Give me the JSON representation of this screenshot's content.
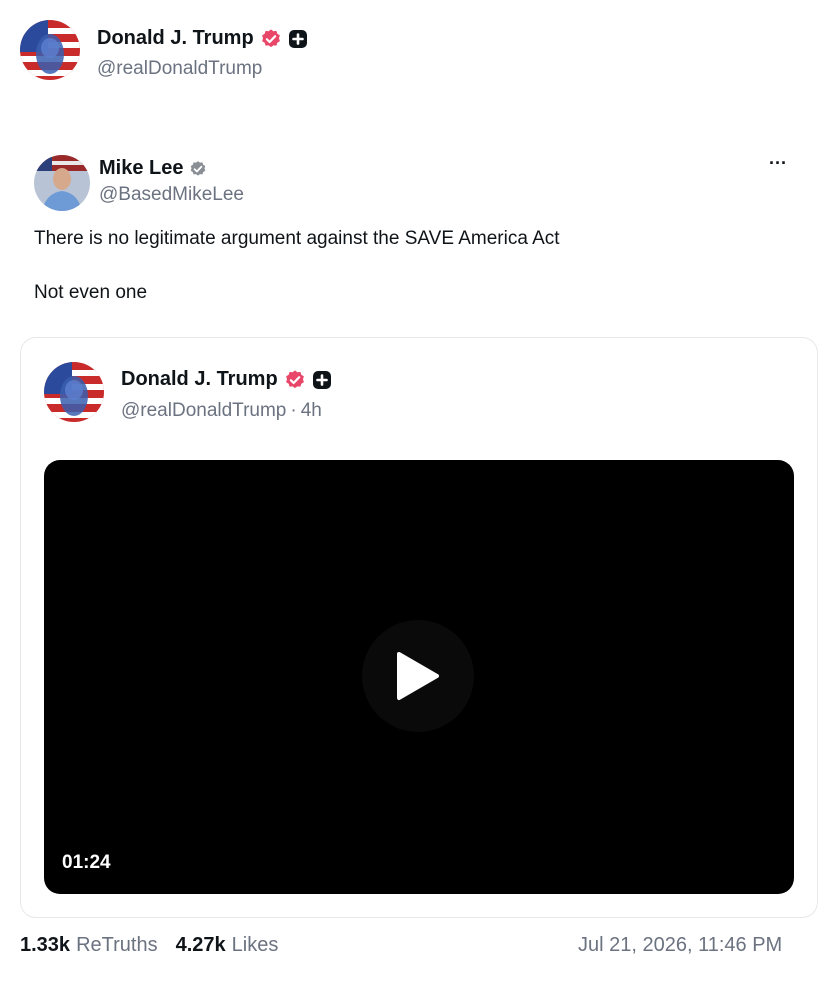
{
  "header": {
    "author_name": "Donald J. Trump",
    "author_handle": "@realDonaldTrump"
  },
  "post": {
    "author_name": "Mike Lee",
    "author_handle": "@BasedMikeLee",
    "text_line1": "There is no legitimate argument against the SAVE America Act",
    "text_line2": "Not even one",
    "more_label": "···"
  },
  "quote": {
    "author_name": "Donald J. Trump",
    "author_handle": "@realDonaldTrump",
    "separator": "·",
    "age": "4h",
    "video_duration": "01:24"
  },
  "stats": {
    "retruths_count": "1.33k",
    "retruths_label": "ReTruths",
    "likes_count": "4.27k",
    "likes_label": "Likes",
    "timestamp": "Jul 21, 2026, 11:46 PM"
  },
  "colors": {
    "verified_badge_pink": "#e8476a",
    "verified_badge_gray": "#8a8f96",
    "handle_gray": "#6b7280",
    "video_bg": "#000000"
  },
  "icons": [
    "verified-badge-icon",
    "plus-square-icon",
    "more-icon",
    "play-icon"
  ]
}
